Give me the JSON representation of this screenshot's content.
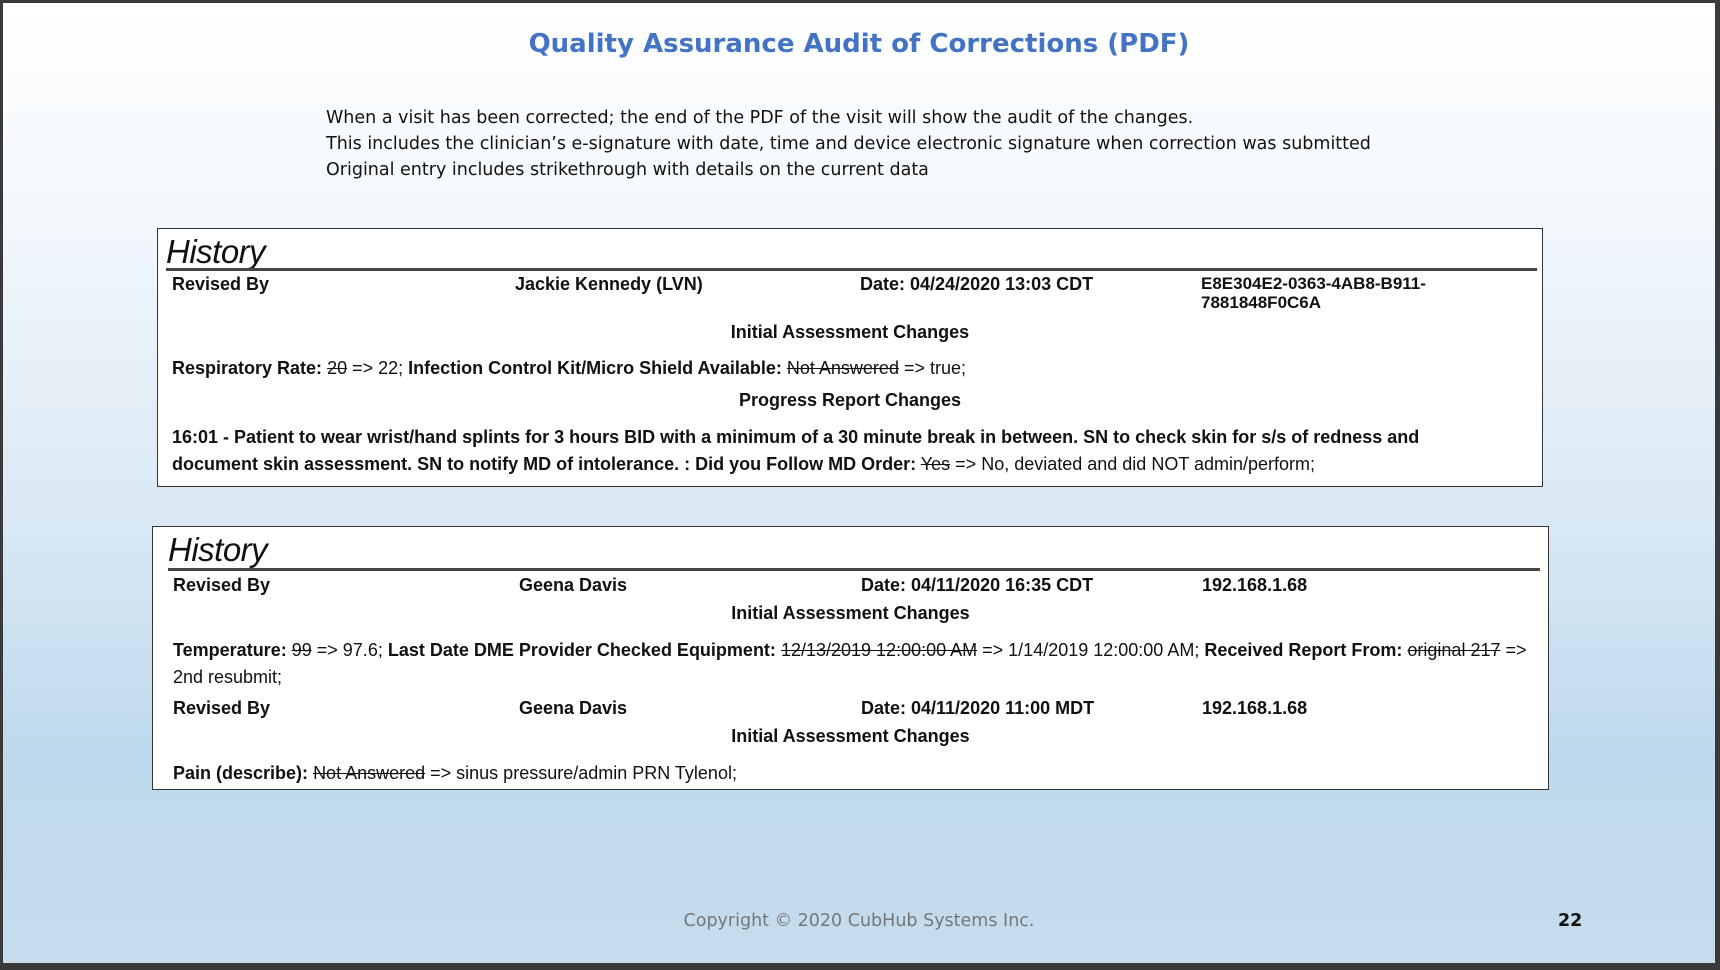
{
  "slide": {
    "title": "Quality Assurance Audit of Corrections (PDF)",
    "intro_lines": [
      "When a visit has been corrected; the end of the PDF of the visit will show the audit of the changes.",
      "This includes the clinician’s e-signature with date, time and device electronic signature when correction was submitted",
      "Original entry includes strikethrough with details on the current data"
    ],
    "footer": "Copyright © 2020 CubHub Systems Inc.",
    "page_number": "22"
  },
  "history1": {
    "title": "History",
    "revised_by_label": "Revised By",
    "name": "Jackie Kennedy (LVN)",
    "date": "Date: 04/24/2020 13:03 CDT",
    "device_line1": "E8E304E2-0363-4AB8-B911-",
    "device_line2": "7881848F0C6A",
    "section1": "Initial Assessment Changes",
    "rr_label": "Respiratory Rate:",
    "rr_old": "20",
    "rr_new": "=> 22;",
    "ick_label": "Infection Control Kit/Micro Shield Available:",
    "ick_old": "Not Answered",
    "ick_new": "=> true;",
    "section2": "Progress Report Changes",
    "progress_line1": "16:01 - Patient to wear wrist/hand splints for 3 hours BID with a minimum of a 30 minute break in between. SN to check skin for s/s of redness and",
    "progress_line2": "document skin assessment.  SN to notify MD of intolerance. : Did you Follow MD Order:",
    "md_old": "Yes",
    "md_new": "=> No, deviated and did NOT admin/perform;"
  },
  "history2": {
    "title": "History",
    "entry1": {
      "revised_by_label": "Revised By",
      "name": "Geena Davis",
      "date": "Date: 04/11/2020 16:35 CDT",
      "device": "192.168.1.68",
      "section": "Initial Assessment Changes",
      "temp_label": "Temperature:",
      "temp_old": "99",
      "temp_new": "=> 97.6;",
      "dme_label": "Last Date DME Provider Checked Equipment:",
      "dme_old": "12/13/2019 12:00:00 AM",
      "dme_new": "=> 1/14/2019 12:00:00 AM;",
      "report_label": "Received Report From:",
      "report_old": "original 217",
      "report_new": "=> 2nd resubmit;"
    },
    "entry2": {
      "revised_by_label": "Revised By",
      "name": "Geena Davis",
      "date": "Date: 04/11/2020 11:00 MDT",
      "device": "192.168.1.68",
      "section": "Initial Assessment Changes",
      "pain_label": "Pain (describe):",
      "pain_old": "Not Answered",
      "pain_new": "=> sinus pressure/admin PRN Tylenol;"
    }
  }
}
